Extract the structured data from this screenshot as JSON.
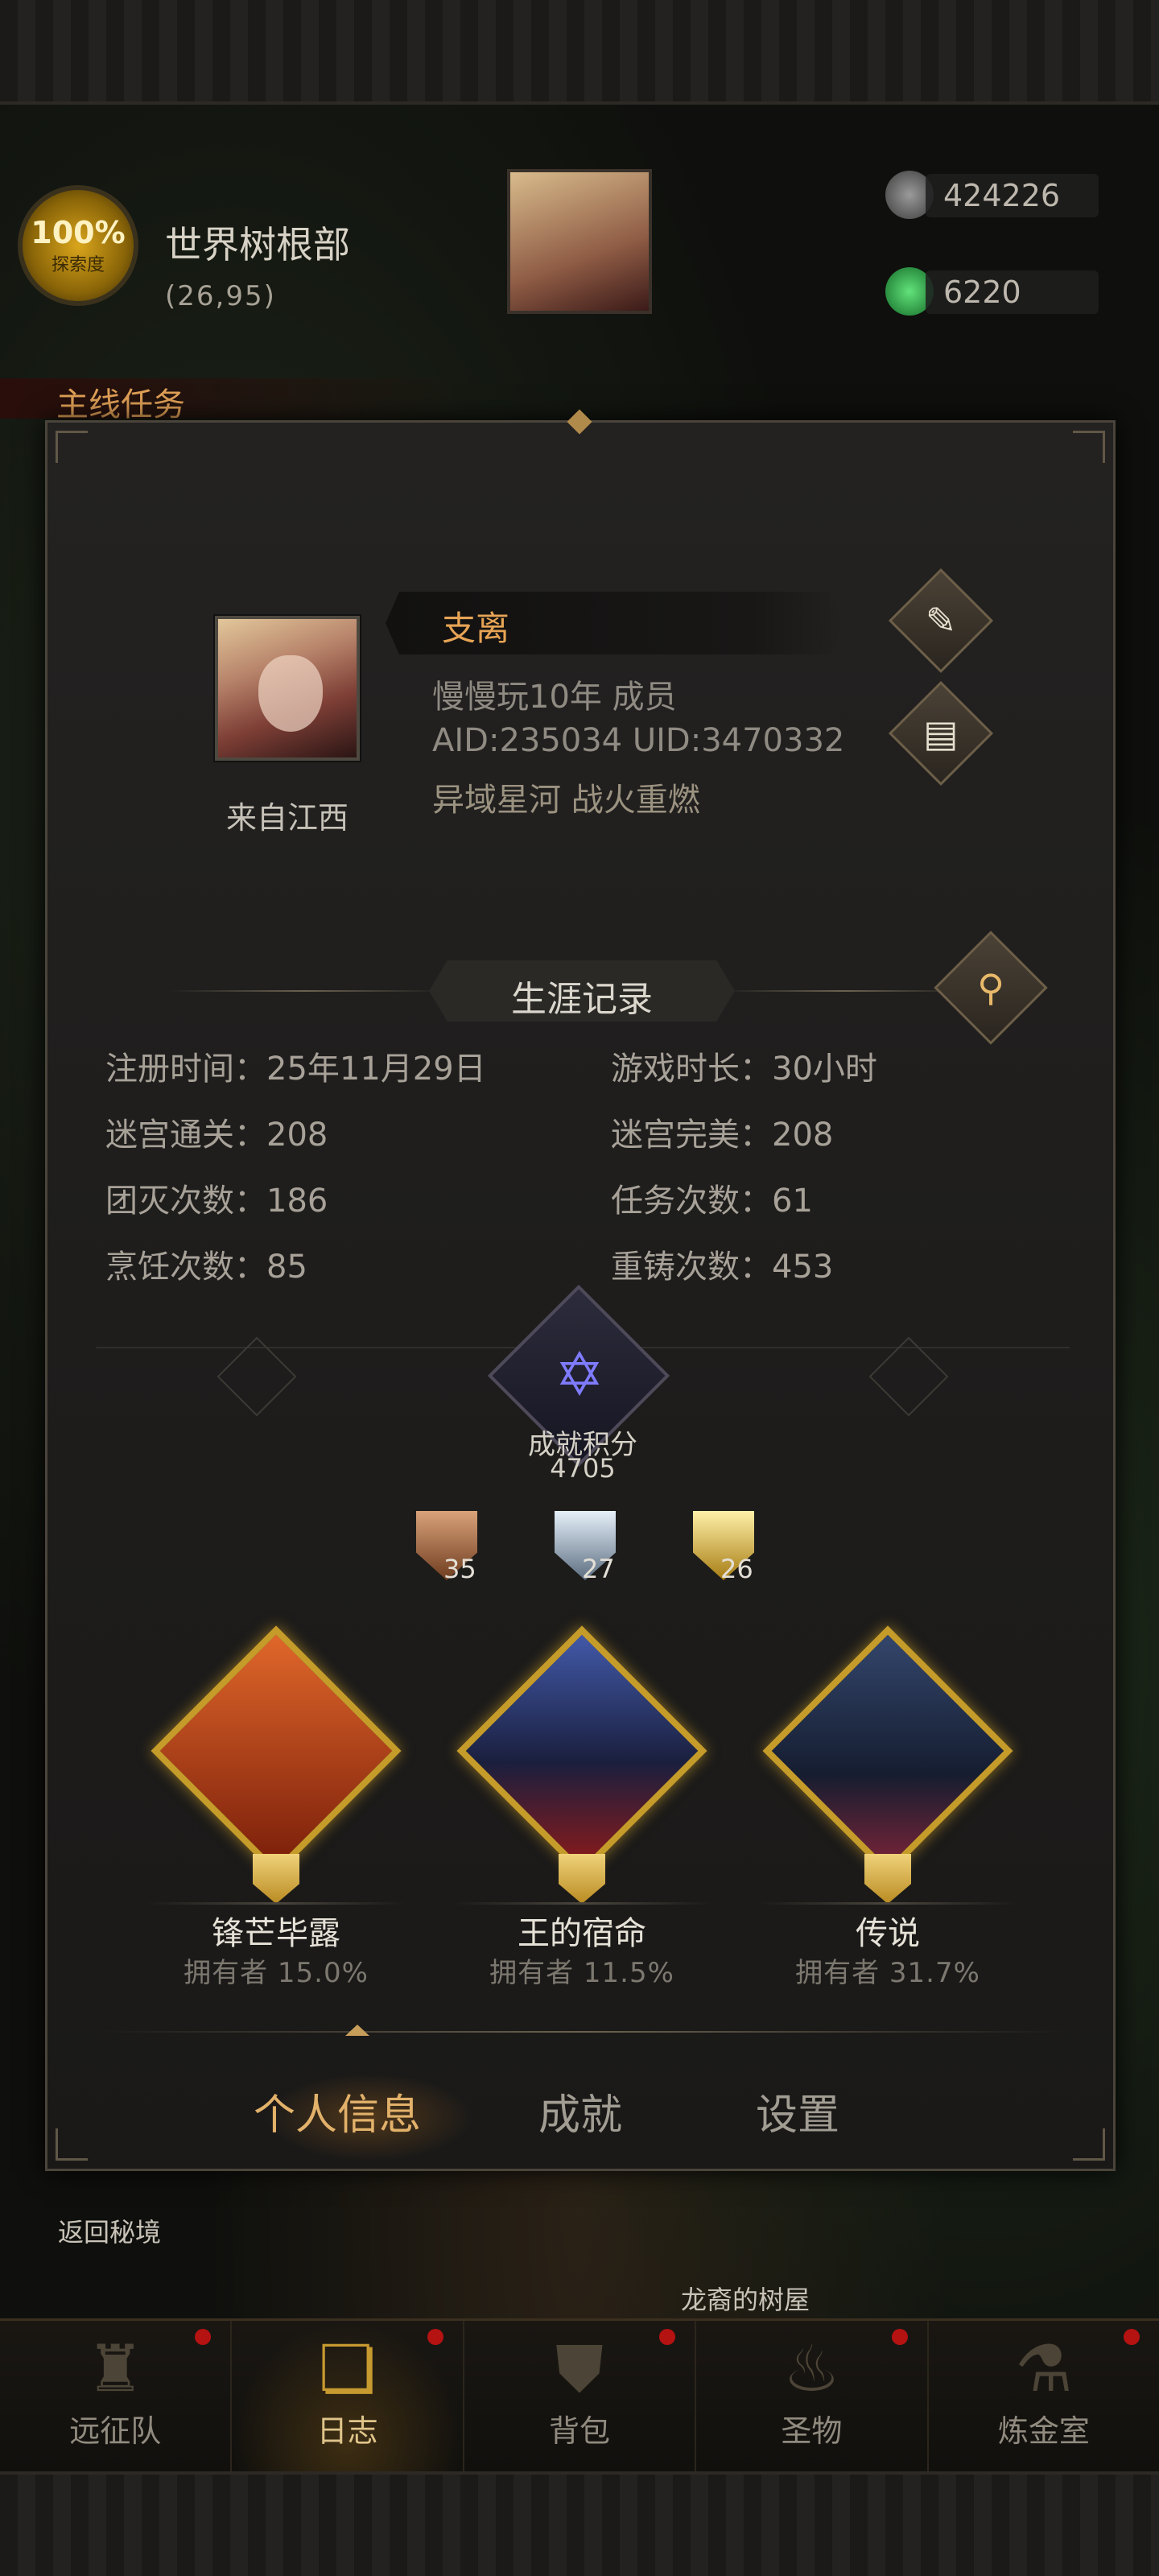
{
  "hud": {
    "explore_percent": "100%",
    "explore_label": "探索度",
    "area_name": "世界树根部",
    "coordinates": "(26,95)",
    "resources": [
      {
        "icon": "stone-icon",
        "value": "424226",
        "color": "#6e6e6e"
      },
      {
        "icon": "emerald-icon",
        "value": "6220",
        "color": "#2fa24a"
      }
    ],
    "quest_label": "主线任务"
  },
  "background_labels": {
    "return": "返回秘境",
    "location": "龙裔的树屋"
  },
  "profile": {
    "name": "支离",
    "title_line": "慢慢玩10年  成员",
    "id_line": "AID:235034 UID:3470332",
    "server_line": "异域星河  战火重燃",
    "origin": "来自江西",
    "edit_icon": "quill-icon",
    "record_icon": "scroll-icon"
  },
  "career": {
    "title": "生涯记录",
    "search_icon": "magnifier-icon",
    "stats": [
      {
        "label": "注册时间：",
        "value": "25年11月29日"
      },
      {
        "label": "游戏时长：",
        "value": "30小时"
      },
      {
        "label": "迷宫通关：",
        "value": "208"
      },
      {
        "label": "迷宫完美：",
        "value": "208"
      },
      {
        "label": "团灭次数：",
        "value": "186"
      },
      {
        "label": "任务次数：",
        "value": "61"
      },
      {
        "label": "烹饪次数：",
        "value": "85"
      },
      {
        "label": "重铸次数：",
        "value": "453"
      }
    ]
  },
  "achievement": {
    "score_label": "成就积分",
    "score_value": "4705",
    "medals": [
      {
        "tier": "bronze",
        "count": "35",
        "color": "#b0764a"
      },
      {
        "tier": "silver",
        "count": "27",
        "color": "#a9bcd0"
      },
      {
        "tier": "gold",
        "count": "26",
        "color": "#d8b23c"
      }
    ],
    "featured": [
      {
        "name": "锋芒毕露",
        "owners": "拥有者 15.0%",
        "bg": "#c3461a"
      },
      {
        "name": "王的宿命",
        "owners": "拥有者 11.5%",
        "bg": "#2b3b78"
      },
      {
        "name": "传说",
        "owners": "拥有者 31.7%",
        "bg": "#1f2b44"
      }
    ]
  },
  "tabs": [
    {
      "label": "个人信息",
      "active": true
    },
    {
      "label": "成就",
      "active": false
    },
    {
      "label": "设置",
      "active": false
    }
  ],
  "bottom_nav": [
    {
      "label": "远征队",
      "icon": "helmet-icon",
      "glyph": "♜",
      "active": false
    },
    {
      "label": "日志",
      "icon": "journal-icon",
      "glyph": "❏",
      "active": true
    },
    {
      "label": "背包",
      "icon": "backpack-icon",
      "glyph": "⛊",
      "active": false
    },
    {
      "label": "圣物",
      "icon": "brazier-icon",
      "glyph": "♨",
      "active": false
    },
    {
      "label": "炼金室",
      "icon": "alchemy-icon",
      "glyph": "⚗",
      "active": false
    }
  ]
}
